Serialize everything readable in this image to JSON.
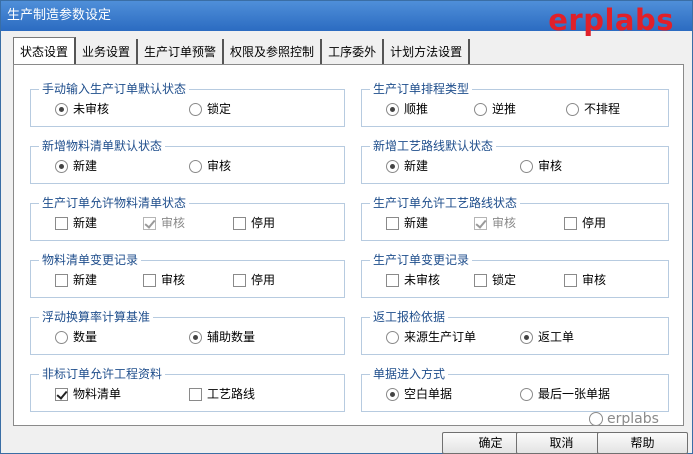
{
  "window": {
    "title": "生产制造参数设定"
  },
  "brand": {
    "logo_text": "erplabs"
  },
  "tabs": [
    {
      "label": "状态设置",
      "active": true
    },
    {
      "label": "业务设置",
      "active": false
    },
    {
      "label": "生产订单预警",
      "active": false
    },
    {
      "label": "权限及参照控制",
      "active": false
    },
    {
      "label": "工序委外",
      "active": false
    },
    {
      "label": "计划方法设置",
      "active": false
    }
  ],
  "groups": {
    "manual_order_status": {
      "title": "手动输入生产订单默认状态",
      "options": [
        "未审核",
        "锁定"
      ],
      "selected": 0
    },
    "order_schedule_type": {
      "title": "生产订单排程类型",
      "options": [
        "顺推",
        "逆推",
        "不排程"
      ],
      "selected": 0
    },
    "new_bom_status": {
      "title": "新增物料清单默认状态",
      "options": [
        "新建",
        "审核"
      ],
      "selected": 0
    },
    "new_route_status": {
      "title": "新增工艺路线默认状态",
      "options": [
        "新建",
        "审核"
      ],
      "selected": 0
    },
    "order_allow_bom_status": {
      "title": "生产订单允许物料清单状态",
      "options": [
        "新建",
        "审核",
        "停用"
      ],
      "checked": [
        false,
        true,
        false
      ],
      "disabled": [
        false,
        true,
        false
      ]
    },
    "order_allow_route_status": {
      "title": "生产订单允许工艺路线状态",
      "options": [
        "新建",
        "审核",
        "停用"
      ],
      "checked": [
        false,
        true,
        false
      ],
      "disabled": [
        false,
        true,
        false
      ]
    },
    "bom_change_log": {
      "title": "物料清单变更记录",
      "options": [
        "新建",
        "审核",
        "停用"
      ],
      "checked": [
        false,
        false,
        false
      ]
    },
    "order_change_log": {
      "title": "生产订单变更记录",
      "options": [
        "未审核",
        "锁定",
        "审核"
      ],
      "checked": [
        false,
        false,
        false
      ]
    },
    "float_calc_basis": {
      "title": "浮动换算率计算基准",
      "options": [
        "数量",
        "辅助数量"
      ],
      "selected": 1
    },
    "rework_basis": {
      "title": "返工报检依据",
      "options": [
        "来源生产订单",
        "返工单"
      ],
      "selected": 1
    },
    "nonstd_order_allow": {
      "title": "非标订单允许工程资料",
      "options": [
        "物料清单",
        "工艺路线"
      ],
      "checked": [
        true,
        false
      ]
    },
    "document_entry_mode": {
      "title": "单据进入方式",
      "options": [
        "空白单据",
        "最后一张单据"
      ],
      "selected": 0
    }
  },
  "watermark": {
    "text": "erplabs"
  },
  "buttons": {
    "ok": "确定",
    "cancel": "取消",
    "help": "帮助"
  }
}
